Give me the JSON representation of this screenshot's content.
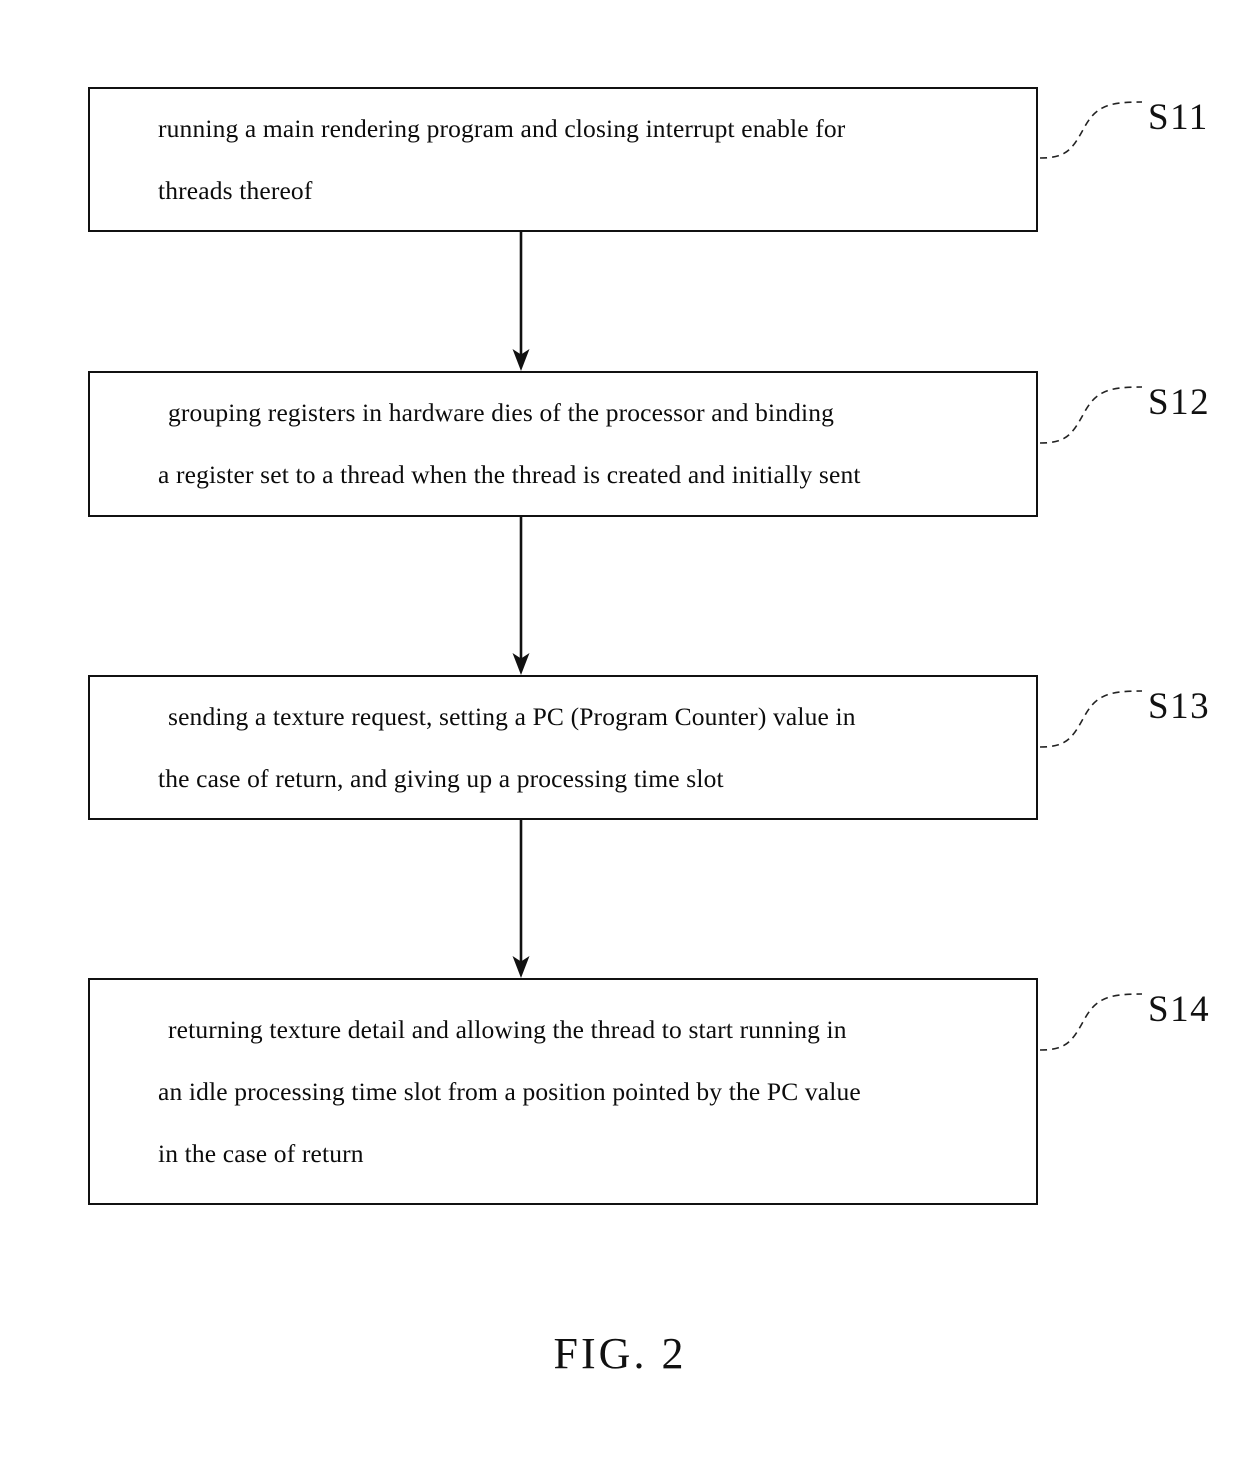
{
  "figure": {
    "caption": "FIG. 2",
    "type": "flowchart",
    "orientation": "vertical",
    "colors": {
      "background": "#ffffff",
      "stroke": "#111111",
      "text": "#0c0c0c"
    }
  },
  "steps": [
    {
      "id": "S11",
      "label": "S11",
      "lines": [
        "running a main rendering program and closing interrupt enable for",
        "threads thereof"
      ]
    },
    {
      "id": "S12",
      "label": "S12",
      "lines": [
        "grouping registers in hardware dies of the processor and binding",
        "a register set to a thread when the thread is created and initially sent"
      ]
    },
    {
      "id": "S13",
      "label": "S13",
      "lines": [
        "sending a texture request, setting a PC (Program Counter) value in",
        "the case of return, and giving up a processing time slot"
      ]
    },
    {
      "id": "S14",
      "label": "S14",
      "lines": [
        "returning texture detail and allowing the thread to start running in",
        "an idle processing time slot from a position pointed by the PC value",
        "in the case of return"
      ]
    }
  ],
  "connectors": [
    {
      "from": "S11",
      "to": "S12",
      "style": "arrow-down"
    },
    {
      "from": "S12",
      "to": "S13",
      "style": "arrow-down"
    },
    {
      "from": "S13",
      "to": "S14",
      "style": "arrow-down"
    }
  ],
  "leaders": [
    {
      "for": "S11",
      "style": "dashed-s-curve"
    },
    {
      "for": "S12",
      "style": "dashed-s-curve"
    },
    {
      "for": "S13",
      "style": "dashed-s-curve"
    },
    {
      "for": "S14",
      "style": "dashed-s-curve"
    }
  ]
}
